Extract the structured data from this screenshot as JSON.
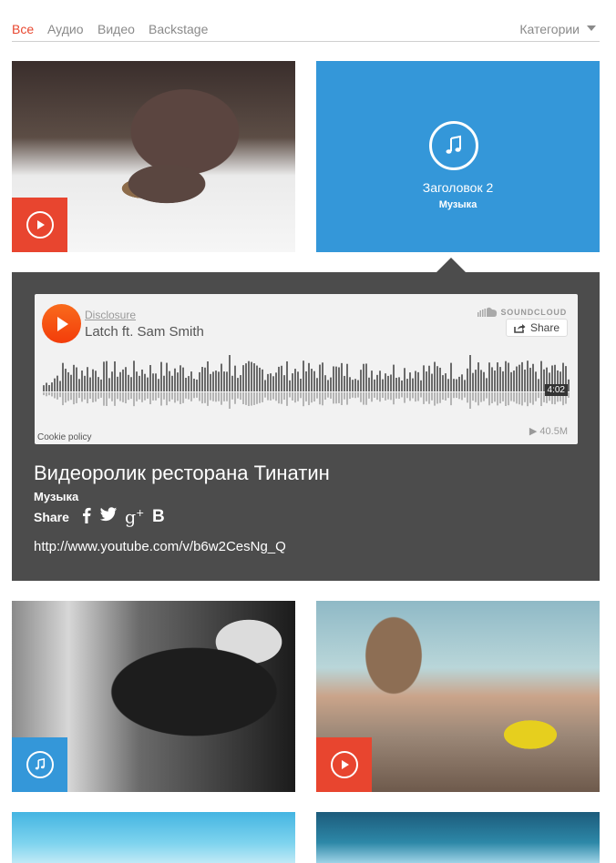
{
  "filters": {
    "items": [
      {
        "label": "Все",
        "active": true
      },
      {
        "label": "Аудио",
        "active": false
      },
      {
        "label": "Видео",
        "active": false
      },
      {
        "label": "Backstage",
        "active": false
      }
    ],
    "categories_label": "Категории"
  },
  "audio_tile": {
    "title": "Заголовок 2",
    "category": "Музыка"
  },
  "player": {
    "artist": "Disclosure",
    "track": "Latch ft. Sam Smith",
    "brand": "SOUNDCLOUD",
    "share_label": "Share",
    "duration": "4:02",
    "cookie_policy": "Cookie policy",
    "plays": "▶ 40.5M"
  },
  "detail": {
    "title": "Видеоролик ресторана Тинатин",
    "category": "Музыка",
    "share_label": "Share",
    "social_icons": [
      "facebook-icon",
      "twitter-icon",
      "google-plus-icon",
      "vk-icon"
    ],
    "link": "http://www.youtube.com/v/b6w2CesNg_Q"
  },
  "tiles": [
    {
      "type": "video",
      "icon": "play-icon"
    },
    {
      "type": "audio",
      "icon": "music-note-icon"
    },
    {
      "type": "audio",
      "icon": "music-note-icon"
    },
    {
      "type": "video",
      "icon": "play-icon"
    },
    {
      "type": "image"
    },
    {
      "type": "image"
    }
  ],
  "colors": {
    "accent_red": "#e8452f",
    "accent_blue": "#3497d9",
    "panel_bg": "#4c4c4c",
    "soundcloud_orange": "#f55d12"
  }
}
